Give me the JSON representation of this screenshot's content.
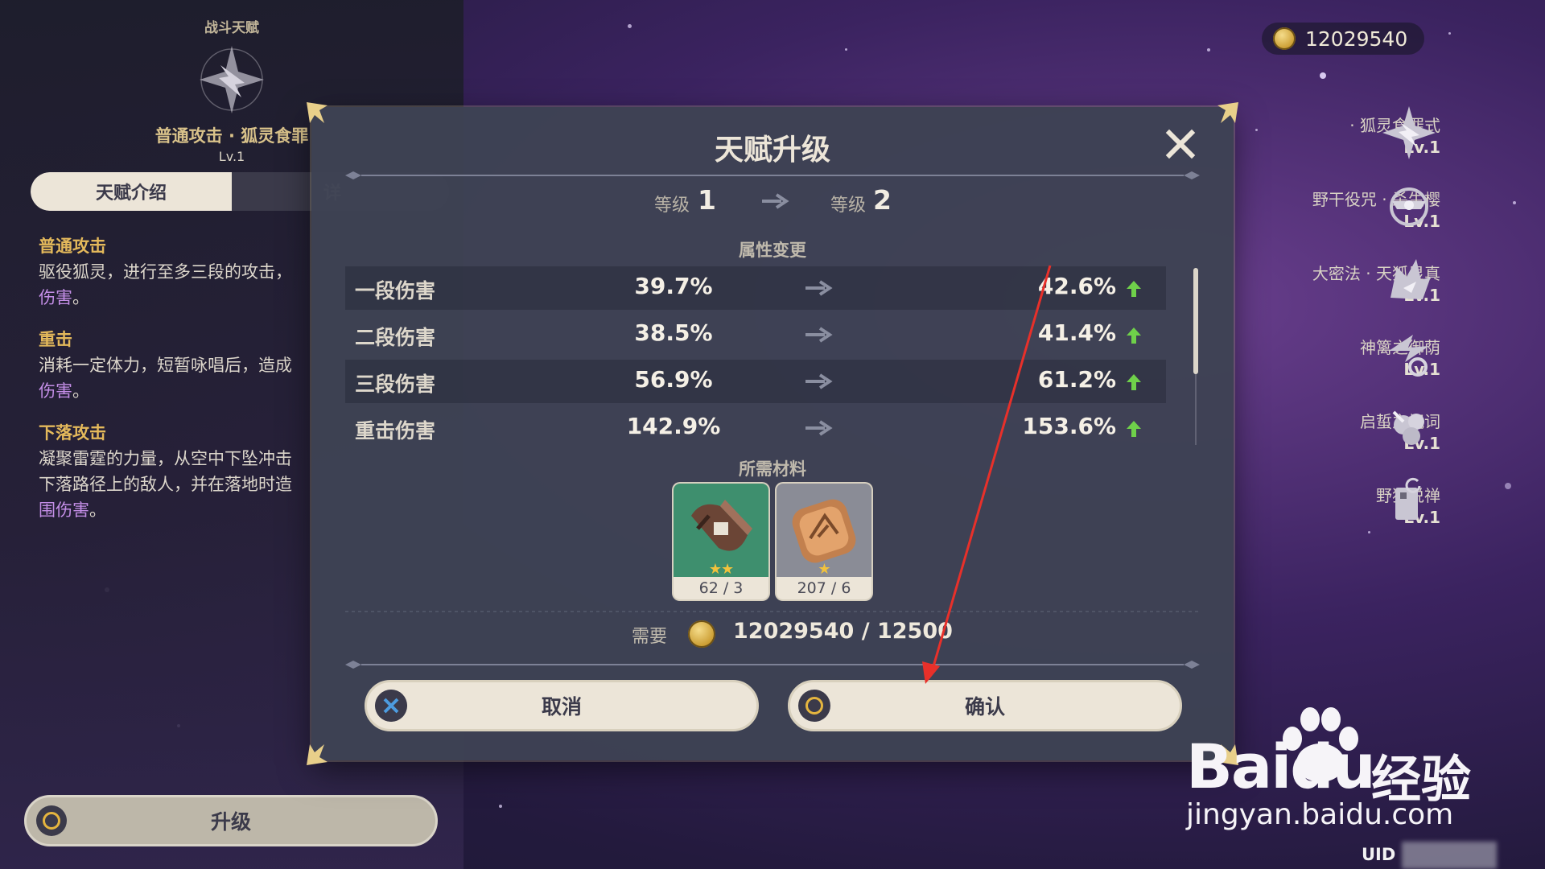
{
  "colors": {
    "accent_gold": "#e4b95b",
    "elemental_purple": "#c48ee7",
    "panel": "#3e4254",
    "button": "#ece5d8",
    "arrow_up": "#6fd14a"
  },
  "left_panel": {
    "category": "战斗天赋",
    "talent_name": "普通攻击 · 狐灵食罪",
    "level": "Lv.1",
    "tabs": [
      "天赋介绍",
      "详"
    ],
    "sections": [
      {
        "heading": "普通攻击",
        "lines": [
          "驱役狐灵，进行至多三段的攻击，"
        ],
        "highlight": "伤害",
        "end": "。"
      },
      {
        "heading": "重击",
        "lines": [
          "消耗一定体力，短暂咏唱后，造成"
        ],
        "highlight": "伤害",
        "end": "。"
      },
      {
        "heading": "下落攻击",
        "lines": [
          "凝聚雷霆的力量，从空中下坠冲击",
          "下落路径上的敌人，并在落地时造"
        ],
        "highlight": "围伤害",
        "end": "。"
      }
    ],
    "upgrade_label": "升级"
  },
  "mora_top": "12029540",
  "talent_list": [
    {
      "name": "· 狐灵食罪式",
      "level": "Lv.1",
      "icon": "fox-star-icon"
    },
    {
      "name": "野干役咒 · 杀生樱",
      "level": "Lv.1",
      "icon": "sakura-totem-icon"
    },
    {
      "name": "大密法 · 天狐显真",
      "level": "Lv.1",
      "icon": "celestial-fox-icon"
    },
    {
      "name": "神篱之御荫",
      "level": "Lv.1",
      "icon": "shrine-blessing-icon"
    },
    {
      "name": "启蜇之祝词",
      "level": "Lv.1",
      "icon": "leaf-blessing-icon"
    },
    {
      "name": "野狐说禅",
      "level": "Lv.1",
      "icon": "book-icon"
    }
  ],
  "dialog": {
    "title": "天赋升级",
    "level_label": "等级",
    "level_from": "1",
    "level_to": "2",
    "attr_title": "属性变更",
    "stats": [
      {
        "name": "一段伤害",
        "old": "39.7%",
        "new": "42.6%"
      },
      {
        "name": "二段伤害",
        "old": "38.5%",
        "new": "41.4%"
      },
      {
        "name": "三段伤害",
        "old": "56.9%",
        "new": "61.2%"
      },
      {
        "name": "重击伤害",
        "old": "142.9%",
        "new": "153.6%"
      }
    ],
    "materials_title": "所需材料",
    "materials": [
      {
        "name": "scroll-material-icon",
        "count": "62 / 3",
        "stars": "★★"
      },
      {
        "name": "seal-material-icon",
        "count": "207 / 6",
        "stars": "★"
      }
    ],
    "require_label": "需要",
    "mora_required": "12029540 / 12500",
    "cancel_label": "取消",
    "confirm_label": "确认"
  },
  "watermark": {
    "brand": "Baidu",
    "cn": "经验",
    "url": "jingyan.baidu.com"
  },
  "uid_label": "UID"
}
